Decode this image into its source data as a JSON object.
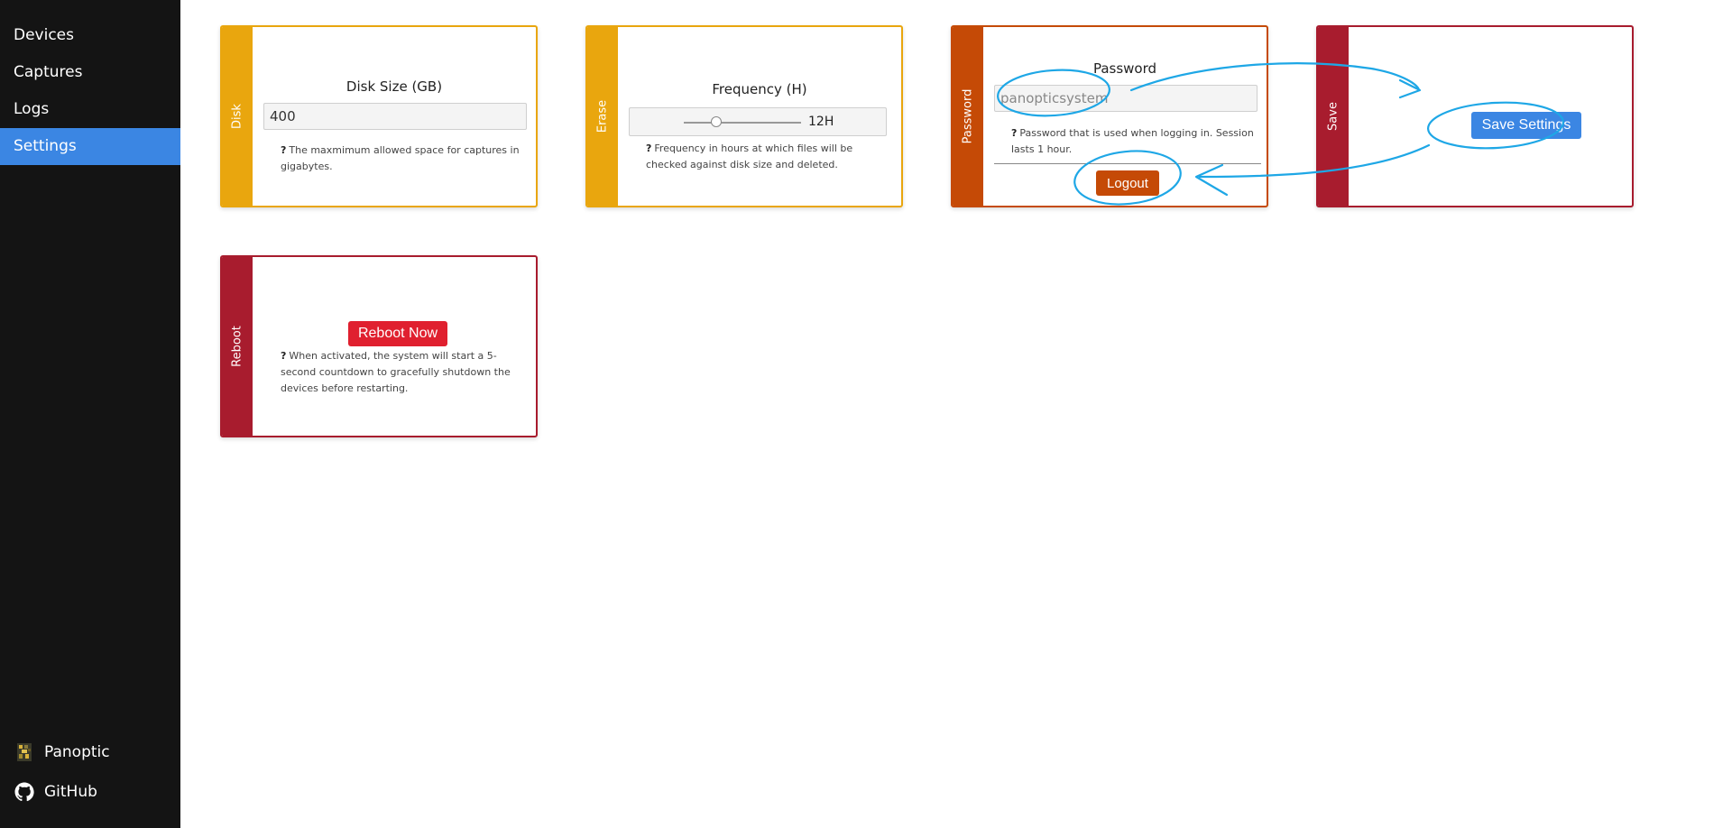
{
  "sidebar": {
    "nav": [
      {
        "label": "Devices"
      },
      {
        "label": "Captures"
      },
      {
        "label": "Logs"
      },
      {
        "label": "Settings",
        "active": true
      }
    ],
    "footer": {
      "app_label": "Panoptic",
      "github_label": "GitHub"
    }
  },
  "cards": {
    "disk": {
      "band": "Disk",
      "title": "Disk Size (GB)",
      "value": "400",
      "help": "The maxmimum allowed space for captures in gigabytes."
    },
    "erase": {
      "band": "Erase",
      "title": "Frequency (H)",
      "slider_value_label": "12H",
      "help": "Frequency in hours at which files will be checked against disk size and deleted."
    },
    "password": {
      "band": "Password",
      "title": "Password",
      "placeholder": "panopticsystem",
      "help": "Password that is used when logging in. Session lasts 1 hour.",
      "logout_label": "Logout"
    },
    "save": {
      "band": "Save",
      "button_label": "Save Settings"
    },
    "reboot": {
      "band": "Reboot",
      "button_label": "Reboot Now",
      "help": "When activated, the system will start a 5-second countdown to gracefully shutdown the devices before restarting."
    }
  },
  "colors": {
    "sidebar_bg": "#141414",
    "active_nav": "#3b86e3",
    "card_yellow": "#e9a60e",
    "card_orange": "#c54a06",
    "card_crimson": "#a81c2e",
    "reboot_button": "#e0202f",
    "annotation": "#1ea7e6"
  }
}
